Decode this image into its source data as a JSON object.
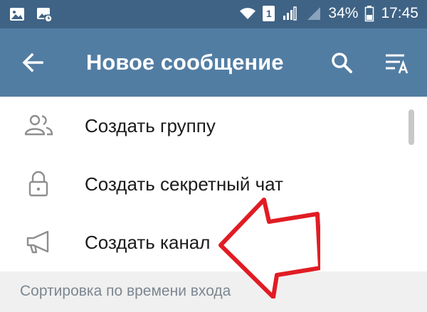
{
  "status_bar": {
    "battery_percent": "34%",
    "time": "17:45",
    "sim_slot": "1"
  },
  "header": {
    "title": "Новое сообщение"
  },
  "menu": {
    "items": [
      {
        "label": "Создать группу",
        "icon": "group-icon"
      },
      {
        "label": "Создать секретный чат",
        "icon": "lock-icon"
      },
      {
        "label": "Создать канал",
        "icon": "megaphone-icon"
      }
    ]
  },
  "sort": {
    "label": "Сортировка по времени входа"
  },
  "colors": {
    "status_bar": "#3f6385",
    "app_bar": "#527da3",
    "annotation_arrow": "#e11c24",
    "section_background": "#f0f0f0"
  }
}
